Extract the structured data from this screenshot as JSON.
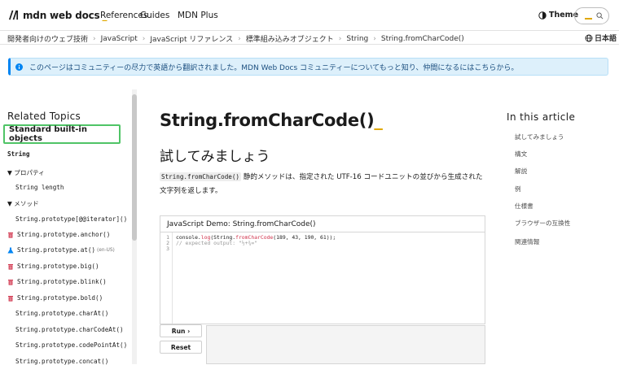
{
  "header": {
    "logo_text": "mdn web docs",
    "logo_cursor": "_",
    "nav": [
      "References",
      "Guides",
      "MDN Plus"
    ],
    "theme_label": "Theme",
    "search_cursor": "_"
  },
  "breadcrumbs": [
    "開発者向けのウェブ技術",
    "JavaScript",
    "JavaScript リファレンス",
    "標準組み込みオブジェクト",
    "String",
    "String.fromCharCode()"
  ],
  "language": "日本語",
  "notice": "このページはコミュニティーの尽力で英語から翻訳されました。MDN Web Docs コミュニティーについてもっと知り、仲間になるにはこちらから。",
  "sidebar": {
    "heading": "Related Topics",
    "selected": "Standard built-in objects",
    "items": [
      {
        "label": "String",
        "bold": true
      },
      {
        "label": "▼ プロパティ",
        "sans": true
      },
      {
        "label": "String length",
        "indent": true
      },
      {
        "label": "▼ メソッド",
        "sans": true
      },
      {
        "label": "String.prototype[@@iterator]()",
        "indent": true
      },
      {
        "label": "String.prototype.anchor()",
        "icon": "trash-icon"
      },
      {
        "label": "String.prototype.at()",
        "icon": "flask-icon",
        "note": "(en-US)"
      },
      {
        "label": "String.prototype.big()",
        "icon": "trash-icon"
      },
      {
        "label": "String.prototype.blink()",
        "icon": "trash-icon"
      },
      {
        "label": "String.prototype.bold()",
        "icon": "trash-icon"
      },
      {
        "label": "String.prototype.charAt()",
        "indent": true
      },
      {
        "label": "String.prototype.charCodeAt()",
        "indent": true
      },
      {
        "label": "String.prototype.codePointAt()",
        "indent": true
      },
      {
        "label": "String.prototype.concat()",
        "indent": true
      }
    ]
  },
  "main": {
    "title": "String.fromCharCode()",
    "title_cursor": "_",
    "subtitle": "試してみましょう",
    "desc_code": "String.fromCharCode()",
    "desc_text": " 静的メソッドは、指定された UTF-16 コードユニットの並びから生成された文字列を返します。",
    "demo_title": "JavaScript Demo: String.fromCharCode()",
    "code_line1_a": "console.",
    "code_line1_b": "log",
    "code_line1_c": "(String.",
    "code_line1_d": "fromCharCode",
    "code_line1_e": "(189, 43, 190, 61));",
    "code_line2": "// expected output: \"½+¾=\"",
    "line_numbers": [
      "1",
      "2",
      "3"
    ],
    "run_label": "Run ›",
    "reset_label": "Reset"
  },
  "toc": {
    "heading": "In this article",
    "items": [
      "試してみましょう",
      "構文",
      "解説",
      "例",
      "仕様書",
      "ブラウザーの互換性",
      "関連情報"
    ]
  },
  "colors": {
    "accent": "#e0a800",
    "selected_border": "#4fc466",
    "notice_bg": "#ddf0fb",
    "notice_bar": "#0085f2",
    "deprecated": "#d0324b",
    "experimental": "#0085f2"
  }
}
